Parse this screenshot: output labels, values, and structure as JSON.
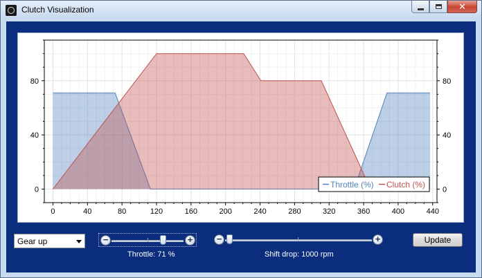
{
  "window": {
    "title": "Clutch Visualization",
    "close_glyph": "✕",
    "icon": "app-icon"
  },
  "controls": {
    "gear_select": {
      "value": "Gear up"
    },
    "throttle": {
      "label": "Throttle: 71 %",
      "value": 71,
      "minus_glyph": "−",
      "plus_glyph": "+"
    },
    "shift_drop": {
      "label": "Shift drop: 1000 rpm",
      "value": 1000,
      "minus_glyph": "−",
      "plus_glyph": "+"
    },
    "update_label": "Update"
  },
  "chart_data": {
    "type": "area",
    "xlim": [
      -10,
      445
    ],
    "ylim": [
      -10,
      110
    ],
    "x_ticks": [
      "0",
      "40",
      "80",
      "120",
      "160",
      "200",
      "240",
      "280",
      "320",
      "360",
      "400",
      "440"
    ],
    "y_ticks": [
      "0",
      "40",
      "80"
    ],
    "series": [
      {
        "name": "Throttle (%)",
        "color": "#4f81bd",
        "points": [
          [
            0,
            71
          ],
          [
            72,
            71
          ],
          [
            113,
            0
          ],
          [
            349,
            0
          ],
          [
            387,
            71
          ],
          [
            437,
            71
          ]
        ]
      },
      {
        "name": "Clutch (%)",
        "color": "#c0504d",
        "points": [
          [
            0,
            0
          ],
          [
            120,
            100
          ],
          [
            221,
            100
          ],
          [
            241,
            80
          ],
          [
            311,
            80
          ],
          [
            368,
            0
          ]
        ]
      }
    ],
    "legend": "bottom-right",
    "grid": true
  }
}
